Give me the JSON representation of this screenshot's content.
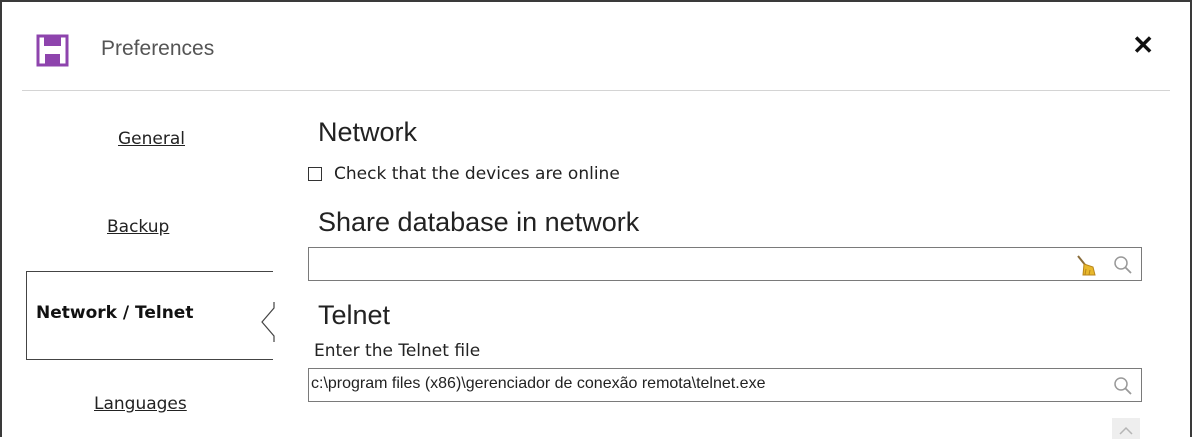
{
  "window": {
    "title": "Preferences",
    "close_label": "✕"
  },
  "nav": {
    "items": [
      {
        "label": "General"
      },
      {
        "label": "Backup"
      },
      {
        "label": "Network / Telnet",
        "active": true
      },
      {
        "label": "Languages"
      }
    ]
  },
  "network": {
    "heading": "Network",
    "check_online_label": "Check that the devices are online",
    "check_online_checked": false
  },
  "share_db": {
    "heading": "Share database in network",
    "value": ""
  },
  "telnet": {
    "heading": "Telnet",
    "file_label": "Enter the Telnet file",
    "file_value": "c:\\program files (x86)\\gerenciador de conexão remota\\telnet.exe"
  },
  "colors": {
    "save_icon": "#8e44ad",
    "accent_border": "#444444",
    "broom_yellow": "#e8b82c"
  },
  "icons": [
    "save-icon",
    "close-icon",
    "broom-icon",
    "magnifier-icon",
    "chevron-left-icon",
    "scroll-up-icon"
  ]
}
